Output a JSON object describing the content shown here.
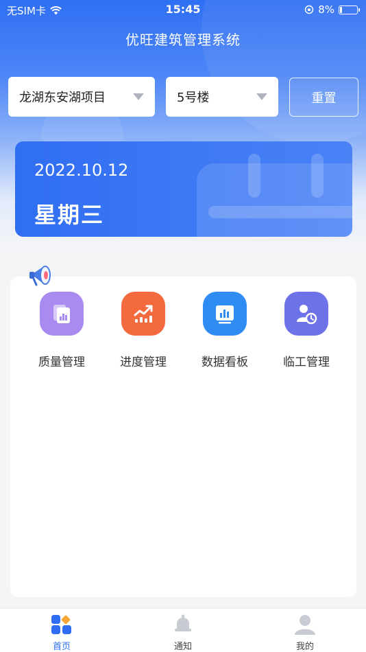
{
  "status": {
    "carrier": "无SIM卡",
    "time": "15:45",
    "battery": "8%"
  },
  "app": {
    "title": "优旺建筑管理系统"
  },
  "filters": {
    "project": "龙湖东安湖项目",
    "building": "5号楼",
    "reset_label": "重置"
  },
  "date_card": {
    "date": "2022.10.12",
    "weekday": "星期三"
  },
  "menu": [
    {
      "label": "质量管理",
      "icon": "document-chart-icon",
      "color": "#a98af0"
    },
    {
      "label": "进度管理",
      "icon": "trend-chart-icon",
      "color": "#f26a3e"
    },
    {
      "label": "数据看板",
      "icon": "bar-chart-icon",
      "color": "#2f8cf3"
    },
    {
      "label": "临工管理",
      "icon": "worker-clock-icon",
      "color": "#6e72e8"
    }
  ],
  "nav": [
    {
      "label": "首页",
      "icon": "home-grid-icon"
    },
    {
      "label": "通知",
      "icon": "bell-icon"
    },
    {
      "label": "我的",
      "icon": "user-icon"
    }
  ],
  "colors": {
    "primary": "#2f6df2",
    "nav_inactive": "#c8cbd2"
  }
}
